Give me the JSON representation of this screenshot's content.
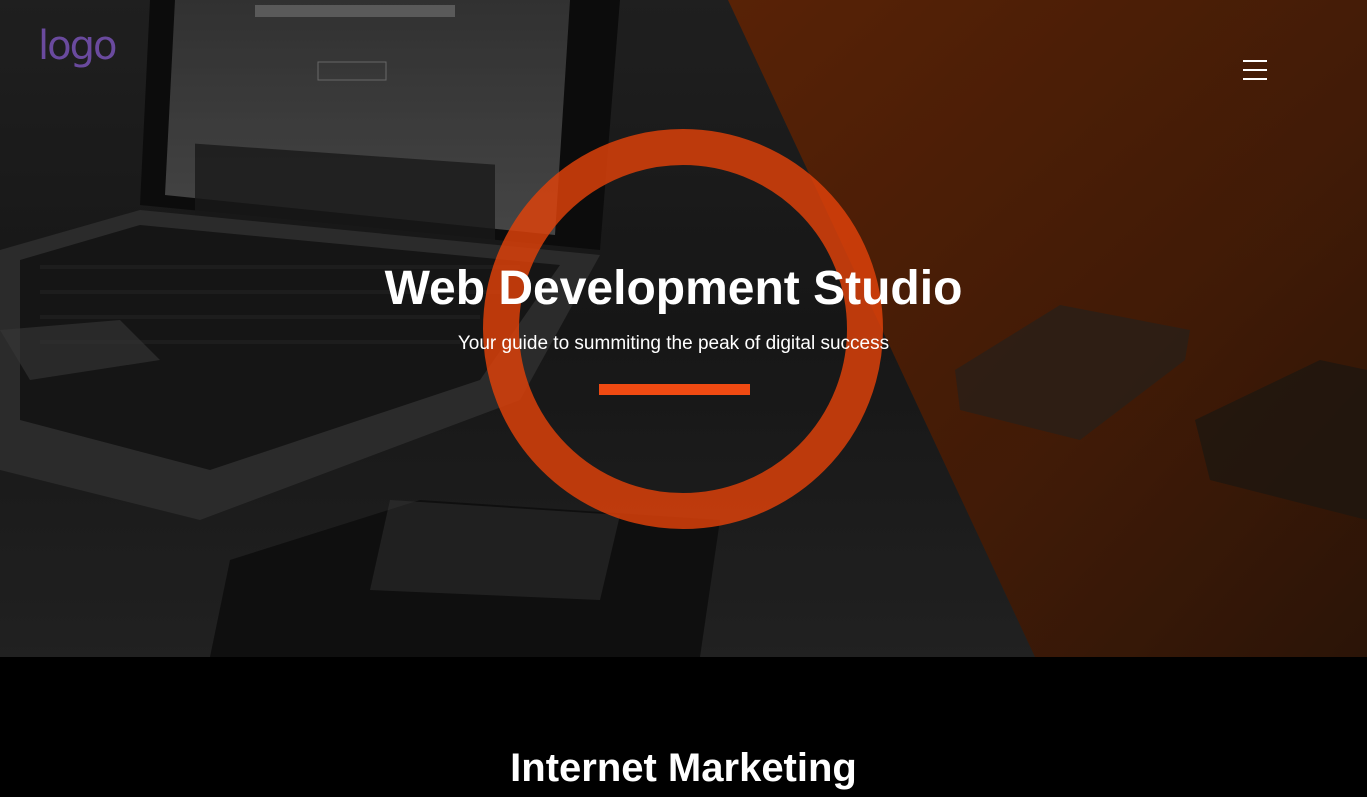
{
  "header": {
    "logo_text": "logo",
    "menu_icon": "hamburger-menu-icon"
  },
  "hero": {
    "title": "Web Development Studio",
    "subtitle": "Your guide to summiting the peak of digital success"
  },
  "section": {
    "title": "Internet Marketing"
  },
  "colors": {
    "accent": "#f04a12",
    "ring": "#e2420a",
    "logo": "#6a4a9e",
    "overlay_orange": "#b8470f",
    "background": "#000000"
  }
}
